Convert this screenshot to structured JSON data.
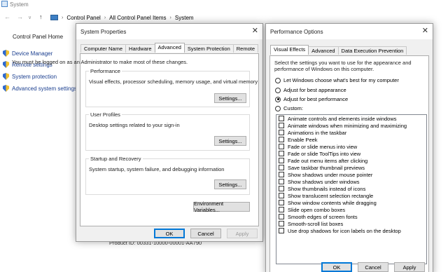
{
  "window": {
    "title": "System"
  },
  "nav": {
    "back_icon": "back-arrow-icon",
    "forward_icon": "forward-arrow-icon",
    "up_icon": "up-arrow-icon",
    "breadcrumb": [
      "Control Panel",
      "All Control Panel Items",
      "System"
    ]
  },
  "left_pane": {
    "home": "Control Panel Home",
    "items": [
      {
        "label": "Device Manager",
        "icon": "shield-icon"
      },
      {
        "label": "Remote settings",
        "icon": "shield-icon"
      },
      {
        "label": "System protection",
        "icon": "shield-icon"
      },
      {
        "label": "Advanced system settings",
        "icon": "shield-icon"
      }
    ]
  },
  "product_id": "Product ID: 00331-10000-00001-AA790",
  "system_properties": {
    "title": "System Properties",
    "tabs": [
      "Computer Name",
      "Hardware",
      "Advanced",
      "System Protection",
      "Remote"
    ],
    "active_tab": "Advanced",
    "note": "You must be logged on as an Administrator to make most of these changes.",
    "groups": [
      {
        "legend": "Performance",
        "desc": "Visual effects, processor scheduling, memory usage, and virtual memory",
        "button": "Settings..."
      },
      {
        "legend": "User Profiles",
        "desc": "Desktop settings related to your sign-in",
        "button": "Settings..."
      },
      {
        "legend": "Startup and Recovery",
        "desc": "System startup, system failure, and debugging information",
        "button": "Settings..."
      }
    ],
    "env_button": "Environment Variables...",
    "ok": "OK",
    "cancel": "Cancel",
    "apply": "Apply"
  },
  "performance_options": {
    "title": "Performance Options",
    "tabs": [
      "Visual Effects",
      "Advanced",
      "Data Execution Prevention"
    ],
    "active_tab": "Visual Effects",
    "intro": "Select the settings you want to use for the appearance and performance of Windows on this computer.",
    "radios": [
      {
        "label": "Let Windows choose what's best for my computer",
        "selected": false
      },
      {
        "label": "Adjust for best appearance",
        "selected": false
      },
      {
        "label": "Adjust for best performance",
        "selected": true
      },
      {
        "label": "Custom:",
        "selected": false
      }
    ],
    "checkboxes": [
      "Animate controls and elements inside windows",
      "Animate windows when minimizing and maximizing",
      "Animations in the taskbar",
      "Enable Peek",
      "Fade or slide menus into view",
      "Fade or slide ToolTips into view",
      "Fade out menu items after clicking",
      "Save taskbar thumbnail previews",
      "Show shadows under mouse pointer",
      "Show shadows under windows",
      "Show thumbnails instead of icons",
      "Show translucent selection rectangle",
      "Show window contents while dragging",
      "Slide open combo boxes",
      "Smooth edges of screen fonts",
      "Smooth-scroll list boxes",
      "Use drop shadows for icon labels on the desktop"
    ],
    "ok": "OK",
    "cancel": "Cancel",
    "apply": "Apply"
  }
}
